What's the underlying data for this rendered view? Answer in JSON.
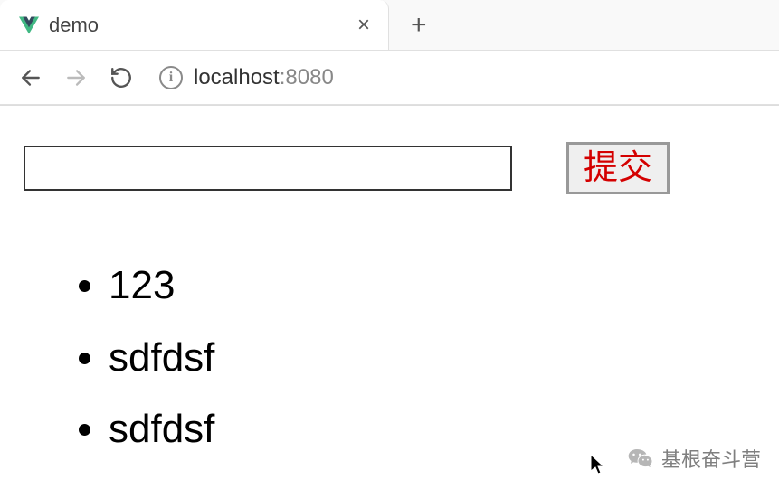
{
  "browser": {
    "tab": {
      "title": "demo",
      "close_glyph": "×",
      "new_tab_glyph": "+"
    },
    "address": {
      "host": "localhost",
      "port": ":8080",
      "info_glyph": "i"
    }
  },
  "form": {
    "input_value": "",
    "input_placeholder": "",
    "submit_label": "提交"
  },
  "list": {
    "items": [
      "123",
      "sdfdsf",
      "sdfdsf"
    ]
  },
  "watermark": {
    "text": "基根奋斗营"
  }
}
